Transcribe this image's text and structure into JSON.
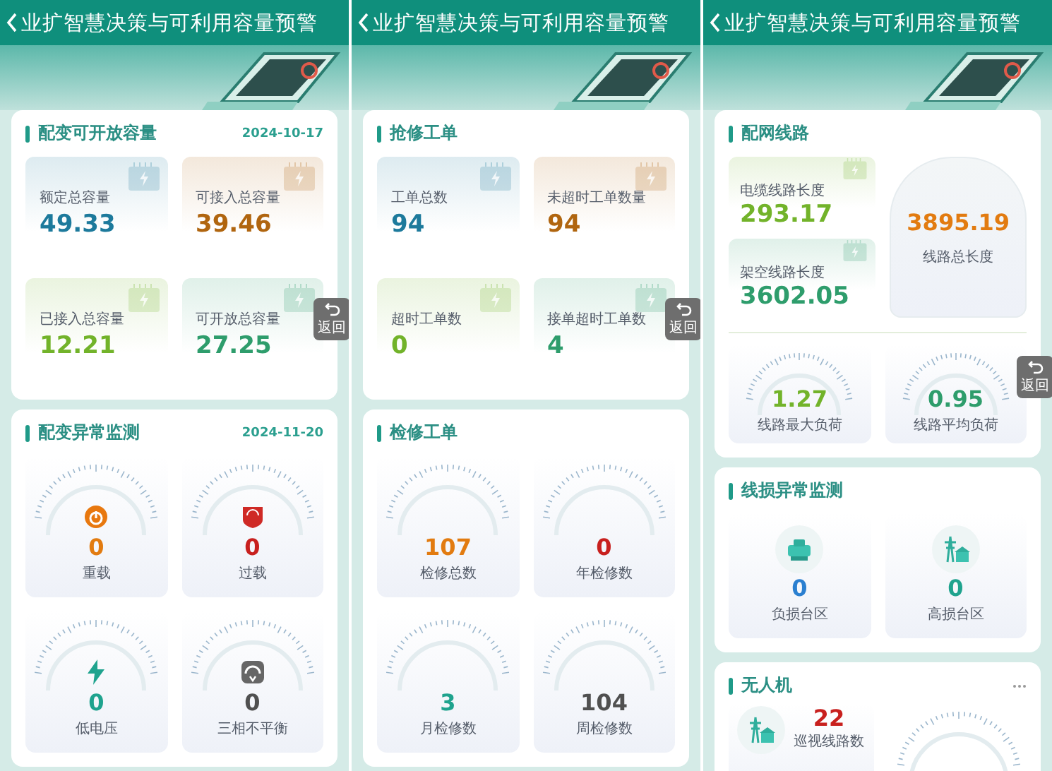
{
  "screens": [
    {
      "title": "业扩智慧决策与可利用容量预警",
      "back_button": "返回",
      "sections": [
        {
          "kind": "tiles",
          "title": "配变可开放容量",
          "date": "2024-10-17",
          "items": [
            {
              "label": "额定总容量",
              "value": "49.33",
              "color": "#1d7a9c"
            },
            {
              "label": "可接入总容量",
              "value": "39.46",
              "color": "#b0650f"
            },
            {
              "label": "已接入总容量",
              "value": "12.21",
              "color": "#72b32a"
            },
            {
              "label": "可开放总容量",
              "value": "27.25",
              "color": "#2e9d6c"
            }
          ]
        },
        {
          "kind": "gauges",
          "title": "配变异常监测",
          "date": "2024-11-20",
          "items": [
            {
              "kind": "dial",
              "label": "重载",
              "value": "0",
              "color": "#e27b10"
            },
            {
              "kind": "shield",
              "label": "过载",
              "value": "0",
              "color": "#c8201e"
            },
            {
              "kind": "bolt",
              "label": "低电压",
              "value": "0",
              "color": "#1fa38e"
            },
            {
              "kind": "meter",
              "label": "三相不平衡",
              "value": "0",
              "color": "#505050"
            }
          ]
        }
      ]
    },
    {
      "title": "业扩智慧决策与可利用容量预警",
      "back_button": "返回",
      "sections": [
        {
          "kind": "tiles",
          "title": "抢修工单",
          "items": [
            {
              "label": "工单总数",
              "value": "94",
              "color": "#1d7a9c"
            },
            {
              "label": "未超时工单数量",
              "value": "94",
              "color": "#b0650f"
            },
            {
              "label": "超时工单数",
              "value": "0",
              "color": "#72b32a"
            },
            {
              "label": "接单超时工单数",
              "value": "4",
              "color": "#2e9d6c"
            }
          ]
        },
        {
          "kind": "gauges",
          "title": "检修工单",
          "items": [
            {
              "kind": "plain",
              "label": "检修总数",
              "value": "107",
              "color": "#e27b10"
            },
            {
              "kind": "plain",
              "label": "年检修数",
              "value": "0",
              "color": "#c8201e"
            },
            {
              "kind": "plain",
              "label": "月检修数",
              "value": "3",
              "color": "#1fa38e"
            },
            {
              "kind": "plain",
              "label": "周检修数",
              "value": "104",
              "color": "#505050"
            }
          ]
        }
      ]
    },
    {
      "title": "业扩智慧决策与可利用容量预警",
      "back_button": "返回",
      "sections": [
        {
          "kind": "network",
          "title": "配网线路",
          "tiles": [
            {
              "label": "电缆线路长度",
              "value": "293.17",
              "color": "#72b32a"
            },
            {
              "label": "架空线路长度",
              "value": "3602.05",
              "color": "#2e9d6c"
            }
          ],
          "total": {
            "label": "线路总长度",
            "value": "3895.19",
            "color": "#e27b10"
          },
          "gauges": [
            {
              "label": "线路最大负荷",
              "value": "1.27",
              "color": "#72b32a"
            },
            {
              "label": "线路平均负荷",
              "value": "0.95",
              "color": "#2e9d6c"
            }
          ]
        },
        {
          "kind": "badges",
          "title": "线损异常监测",
          "items": [
            {
              "kind": "substation",
              "label": "负损台区",
              "value": "0",
              "color": "#2a7fd0"
            },
            {
              "kind": "tower",
              "label": "高损台区",
              "value": "0",
              "color": "#1fa38e"
            }
          ]
        },
        {
          "kind": "drone",
          "title": "无人机",
          "items": [
            {
              "kind": "tower",
              "label": "巡视线路数",
              "value": "22",
              "color": "#c8201e"
            }
          ]
        }
      ]
    }
  ]
}
